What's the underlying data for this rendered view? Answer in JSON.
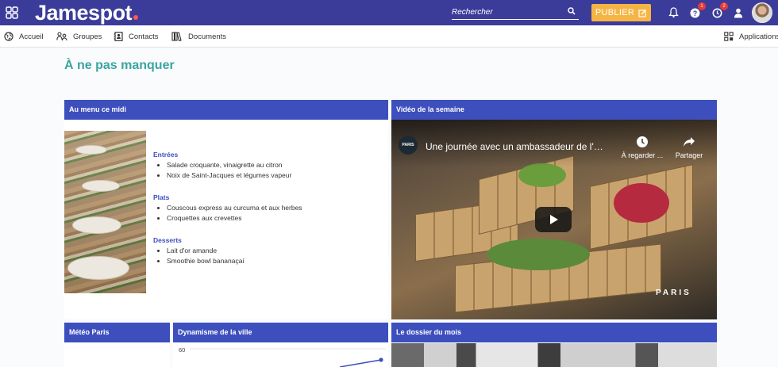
{
  "topbar": {
    "brand": "Jamespot",
    "search_placeholder": "Rechercher",
    "publish_label": "PUBLIER",
    "help_badge": "1",
    "timer_badge": "2",
    "colors": {
      "bar": "#3b3b9a",
      "publish": "#f5b544",
      "brand_dot": "#ff5a4e"
    }
  },
  "nav": {
    "items": [
      {
        "label": "Accueil",
        "icon": "globe-icon"
      },
      {
        "label": "Groupes",
        "icon": "groups-icon"
      },
      {
        "label": "Contacts",
        "icon": "contacts-icon"
      },
      {
        "label": "Documents",
        "icon": "documents-icon"
      }
    ],
    "apps_label": "Applications"
  },
  "page": {
    "title": "À ne pas manquer",
    "title_color": "#3aa5a0"
  },
  "menu_card": {
    "title": "Au menu ce midi",
    "sections": [
      {
        "name": "Entrées",
        "items": [
          "Salade croquante, vinaigrette au citron",
          "Noix de Saint-Jacques et légumes vapeur"
        ]
      },
      {
        "name": "Plats",
        "items": [
          "Couscous express au curcuma et aux herbes",
          "Croquettes aux crevettes"
        ]
      },
      {
        "name": "Desserts",
        "items": [
          "Lait d'or amande",
          "Smoothie bowl bananaçaí"
        ]
      }
    ]
  },
  "video_card": {
    "title": "Vidéo de la semaine",
    "video_title": "Une journée avec un ambassadeur de l'as...",
    "channel": "PARIS",
    "watch_later": "À regarder ...",
    "share": "Partager",
    "watermark": "PARIS"
  },
  "weather_card": {
    "title": "Météo Paris"
  },
  "dynamism_card": {
    "title": "Dynamisme de la ville",
    "axis_tick": "60"
  },
  "dossier_card": {
    "title": "Le dossier du mois"
  },
  "colors": {
    "card_header": "#3d4fbd"
  }
}
